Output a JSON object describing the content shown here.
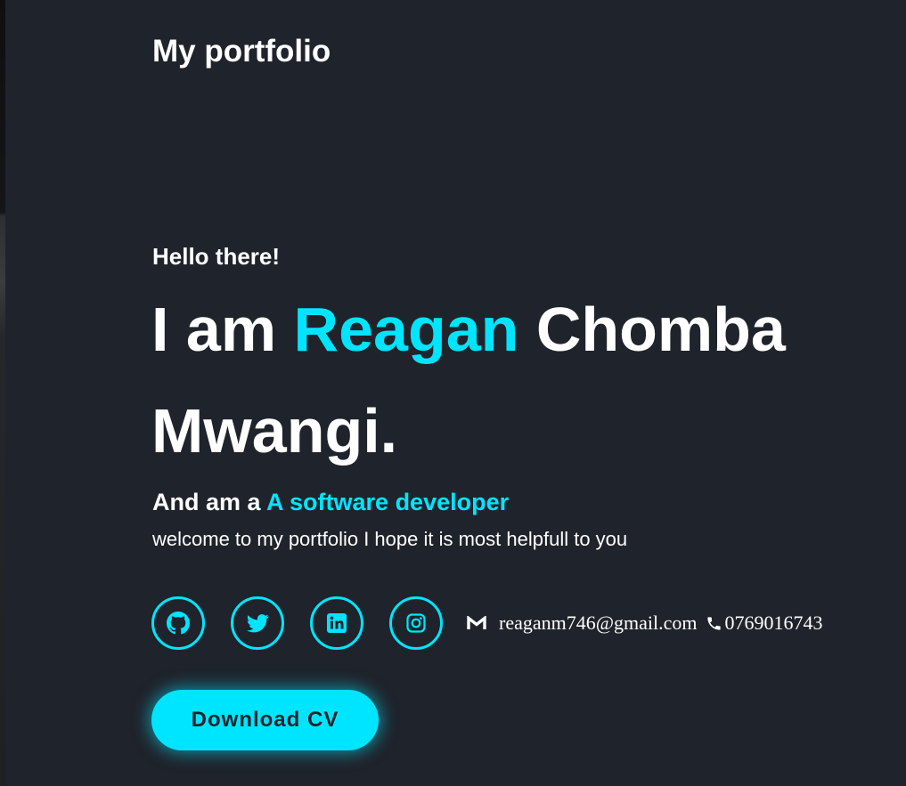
{
  "header": {
    "title": "My portfolio"
  },
  "hero": {
    "greeting": "Hello there!",
    "name_prefix": "I am ",
    "first_name": "Reagan",
    "name_rest": " Chomba Mwangi.",
    "role_prefix": "And am a ",
    "role": "A software developer",
    "tagline": "welcome to my portfolio I hope it is most helpfull to you"
  },
  "social": [
    {
      "name": "github",
      "icon": "github-icon"
    },
    {
      "name": "twitter",
      "icon": "twitter-icon"
    },
    {
      "name": "linkedin",
      "icon": "linkedin-icon"
    },
    {
      "name": "instagram",
      "icon": "instagram-icon"
    }
  ],
  "contact": {
    "email_icon": "gmail-icon",
    "email": "reaganm746@gmail.com",
    "phone_icon": "phone-icon",
    "phone": "0769016743"
  },
  "cta": {
    "download_label": "Download CV"
  },
  "colors": {
    "background": "#1f232b",
    "accent": "#00e5ff",
    "text": "#ffffff"
  }
}
